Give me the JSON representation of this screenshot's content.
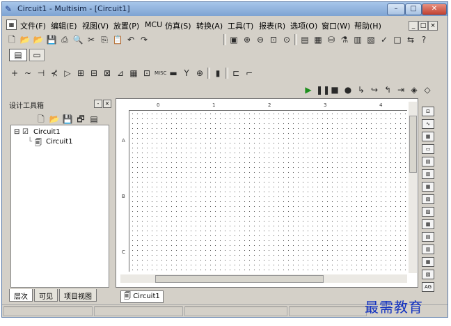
{
  "window": {
    "title": "Circuit1 - Multisim - [Circuit1]",
    "buttons": [
      "–",
      "□",
      "✕"
    ]
  },
  "menu": {
    "items": [
      "文件(F)",
      "编辑(E)",
      "视图(V)",
      "放置(P)",
      "MCU",
      "仿真(S)",
      "转换(A)",
      "工具(T)",
      "报表(R)",
      "选项(O)",
      "窗口(W)",
      "帮助(H)"
    ],
    "mdi_buttons": [
      "_",
      "□",
      "×"
    ]
  },
  "design_toolbox": {
    "title": "设计工具箱",
    "tree": {
      "root": "Circuit1",
      "child": "Circuit1"
    },
    "tabs": [
      "层次",
      "可见",
      "项目视图"
    ]
  },
  "document": {
    "tab_label": "Circuit1",
    "ruler_top_labels": [
      "0",
      "1",
      "2",
      "3",
      "4"
    ],
    "ruler_left_labels": [
      "A",
      "B",
      "C"
    ]
  },
  "watermark": "最需教育",
  "colors": {
    "titlebar": "#7ea3d2",
    "chrome": "#d4d0c8",
    "watermark": "#1030c0",
    "sim_run": "#1e8f1e"
  }
}
